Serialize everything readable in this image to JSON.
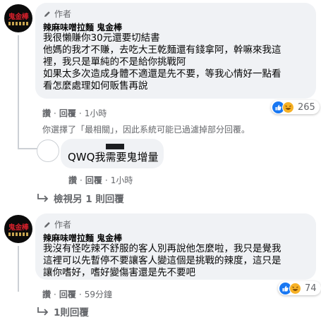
{
  "comment1": {
    "author_badge": "作者",
    "name": "辣麻味噌拉麵 鬼金棒",
    "avatar_text": "鬼金棒",
    "lines": [
      "我很懶賺你30元還要切結書",
      "他媽的我才不賺，去吃大王乾麵還有錢拿阿，幹嘛來我這",
      "裡，我只是單純的不是給你挑戰阿",
      "如果太多次造成身體不適還是先不要，等我心情好一點看",
      "看怎麼處理如何販售再說"
    ],
    "reaction_count": "265",
    "like_label": "讚",
    "reply_label": "回覆",
    "time": "1小時",
    "notice": "你選擇了「最相關」，因此系統可能已過濾掉部分回覆。"
  },
  "reply1": {
    "text": "QWQ我需要鬼增量",
    "like_label": "讚",
    "reply_label": "回覆",
    "time": "1小時"
  },
  "view_more": "檢視另 1 則回覆",
  "comment2": {
    "author_badge": "作者",
    "name": "辣麻味噌拉麵 鬼金棒",
    "avatar_text": "鬼金棒",
    "lines": [
      "我沒有怪吃辣不舒服的客人別再說他怎麼啦，我只是覺我",
      "這裡可以先暫停不要讓客人變這個是挑戰的辣度，這只是",
      "讓你嗜好，嗜好變傷害還是先不要吧"
    ],
    "reaction_count": "74",
    "like_label": "讚",
    "reply_label": "回覆",
    "time": "59分鐘"
  },
  "replies_link": "1則回覆",
  "colors": {
    "bubble": "#f0f2f5",
    "meta": "#65676b",
    "like": "#1877f2",
    "haha": "#f7b125",
    "brand_red": "#d4202b"
  }
}
